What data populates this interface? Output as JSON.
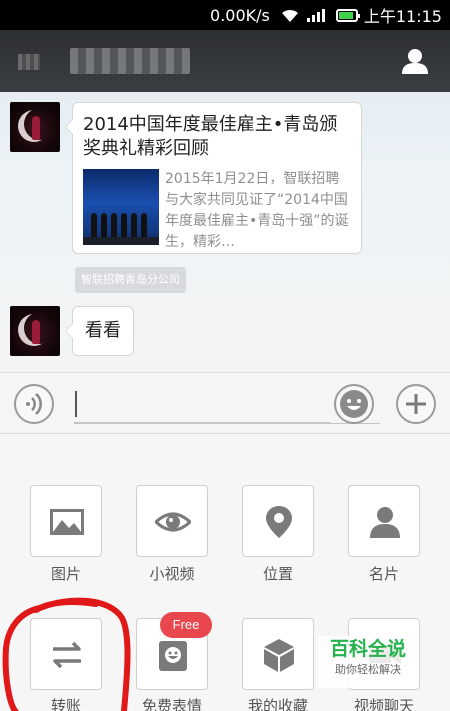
{
  "status_bar": {
    "speed": "0.00K/s",
    "time": "上午11:15",
    "battery_color": "#3ed24a"
  },
  "chat": {
    "card": {
      "title": "2014中国年度最佳雇主•青岛颁奖典礼精彩回顾",
      "description": "2015年1月22日，智联招聘与大家共同见证了“2014中国年度最佳雇主•青岛十强”的诞生，精彩…"
    },
    "source_tag": "智联招聘青岛分公司",
    "reply": "看看"
  },
  "panel": {
    "items": [
      {
        "label": "图片",
        "icon": "image-icon"
      },
      {
        "label": "小视频",
        "icon": "eye-icon"
      },
      {
        "label": "位置",
        "icon": "location-pin-icon"
      },
      {
        "label": "名片",
        "icon": "contact-card-icon"
      },
      {
        "label": "转账",
        "icon": "transfer-icon"
      },
      {
        "label": "免费表情",
        "icon": "sticker-icon"
      },
      {
        "label": "我的收藏",
        "icon": "favorites-box-icon"
      },
      {
        "label": "视频聊天",
        "icon": "video-chat-icon"
      }
    ],
    "free_badge": "Free"
  },
  "watermark": {
    "main": "百科全说",
    "sub": "助你轻松解决"
  },
  "colors": {
    "title_bar": "#2c2f33",
    "badge": "#e8484d",
    "annotation": "#e01818",
    "watermark": "#24b24c"
  }
}
